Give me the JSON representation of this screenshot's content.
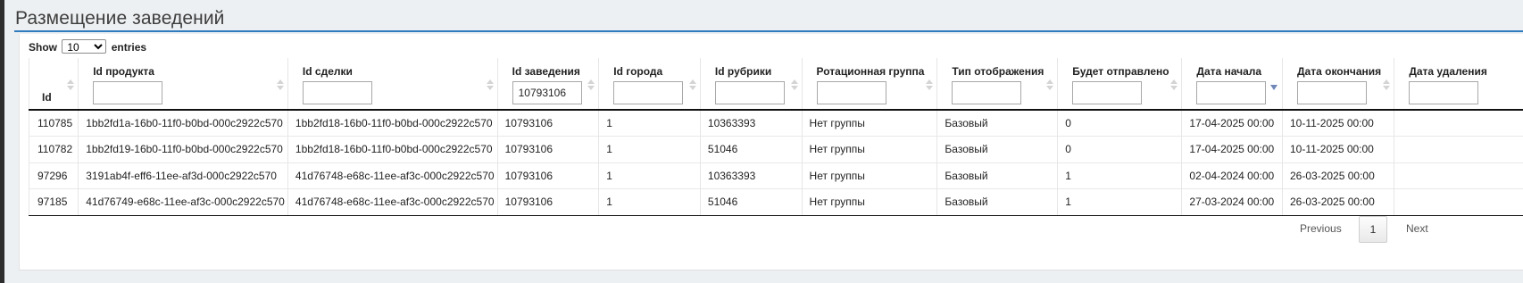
{
  "page": {
    "title": "Размещение заведений"
  },
  "length": {
    "prefix": "Show",
    "value": "10",
    "suffix": "entries"
  },
  "columns": [
    {
      "label": "Id",
      "filter": null
    },
    {
      "label": "Id продукта",
      "filter": ""
    },
    {
      "label": "Id сделки",
      "filter": ""
    },
    {
      "label": "Id заведения",
      "filter": "10793106"
    },
    {
      "label": "Id города",
      "filter": ""
    },
    {
      "label": "Id рубрики",
      "filter": ""
    },
    {
      "label": "Ротационная группа",
      "filter": ""
    },
    {
      "label": "Тип отображения",
      "filter": ""
    },
    {
      "label": "Будет отправлено",
      "filter": ""
    },
    {
      "label": "Дата начала",
      "filter": ""
    },
    {
      "label": "Дата окончания",
      "filter": ""
    },
    {
      "label": "Дата удаления",
      "filter": ""
    }
  ],
  "rows": [
    [
      "110785",
      "1bb2fd1a-16b0-11f0-b0bd-000c2922c570",
      "1bb2fd18-16b0-11f0-b0bd-000c2922c570",
      "10793106",
      "1",
      "10363393",
      "Нет группы",
      "Базовый",
      "0",
      "17-04-2025 00:00",
      "10-11-2025 00:00",
      ""
    ],
    [
      "110782",
      "1bb2fd19-16b0-11f0-b0bd-000c2922c570",
      "1bb2fd18-16b0-11f0-b0bd-000c2922c570",
      "10793106",
      "1",
      "51046",
      "Нет группы",
      "Базовый",
      "0",
      "17-04-2025 00:00",
      "10-11-2025 00:00",
      ""
    ],
    [
      "97296",
      "3191ab4f-eff6-11ee-af3d-000c2922c570",
      "41d76748-e68c-11ee-af3c-000c2922c570",
      "10793106",
      "1",
      "10363393",
      "Нет группы",
      "Базовый",
      "1",
      "02-04-2024 00:00",
      "26-03-2025 00:00",
      ""
    ],
    [
      "97185",
      "41d76749-e68c-11ee-af3c-000c2922c570",
      "41d76748-e68c-11ee-af3c-000c2922c570",
      "10793106",
      "1",
      "51046",
      "Нет группы",
      "Базовый",
      "1",
      "27-03-2024 00:00",
      "26-03-2025 00:00",
      ""
    ]
  ],
  "pagination": {
    "previous": "Previous",
    "current": "1",
    "next": "Next"
  }
}
